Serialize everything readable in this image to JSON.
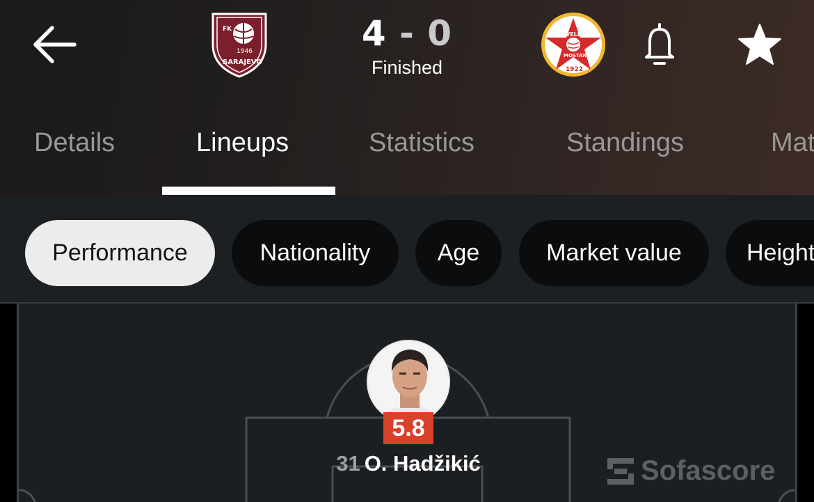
{
  "header": {
    "score": {
      "home": "4",
      "separator": "-",
      "away": "0"
    },
    "status": "Finished",
    "home_team": {
      "crest_text_top": "FK",
      "crest_text_name": "SARAJEVO",
      "crest_year": "1946",
      "crest_color": "#7c1f2c"
    },
    "away_team": {
      "crest_text_top": "VELEŽ",
      "crest_text_city": "MOSTAR",
      "crest_year": "1922",
      "crest_color": "#d62a2a",
      "crest_ring": "#f2b632"
    },
    "icons": {
      "back": "back-arrow-icon",
      "bell": "bell-icon",
      "star": "star-icon"
    }
  },
  "tabs": [
    {
      "label": "Details",
      "active": false
    },
    {
      "label": "Lineups",
      "active": true
    },
    {
      "label": "Statistics",
      "active": false
    },
    {
      "label": "Standings",
      "active": false
    },
    {
      "label": "Matches",
      "active": false
    }
  ],
  "filters": [
    {
      "label": "Performance",
      "active": true
    },
    {
      "label": "Nationality",
      "active": false
    },
    {
      "label": "Age",
      "active": false
    },
    {
      "label": "Market value",
      "active": false
    },
    {
      "label": "Height",
      "active": false
    }
  ],
  "player": {
    "number": "31",
    "name": "O. Hadžikić",
    "rating": "5.8",
    "rating_color": "#d8412a"
  },
  "watermark": "Sofascore",
  "colors": {
    "header_bg": "#221f1e",
    "filter_bg": "#1d2023",
    "pitch_bg": "#1c1f22",
    "chip_active": "#ececec",
    "chip_inactive": "#0b0c0d"
  }
}
